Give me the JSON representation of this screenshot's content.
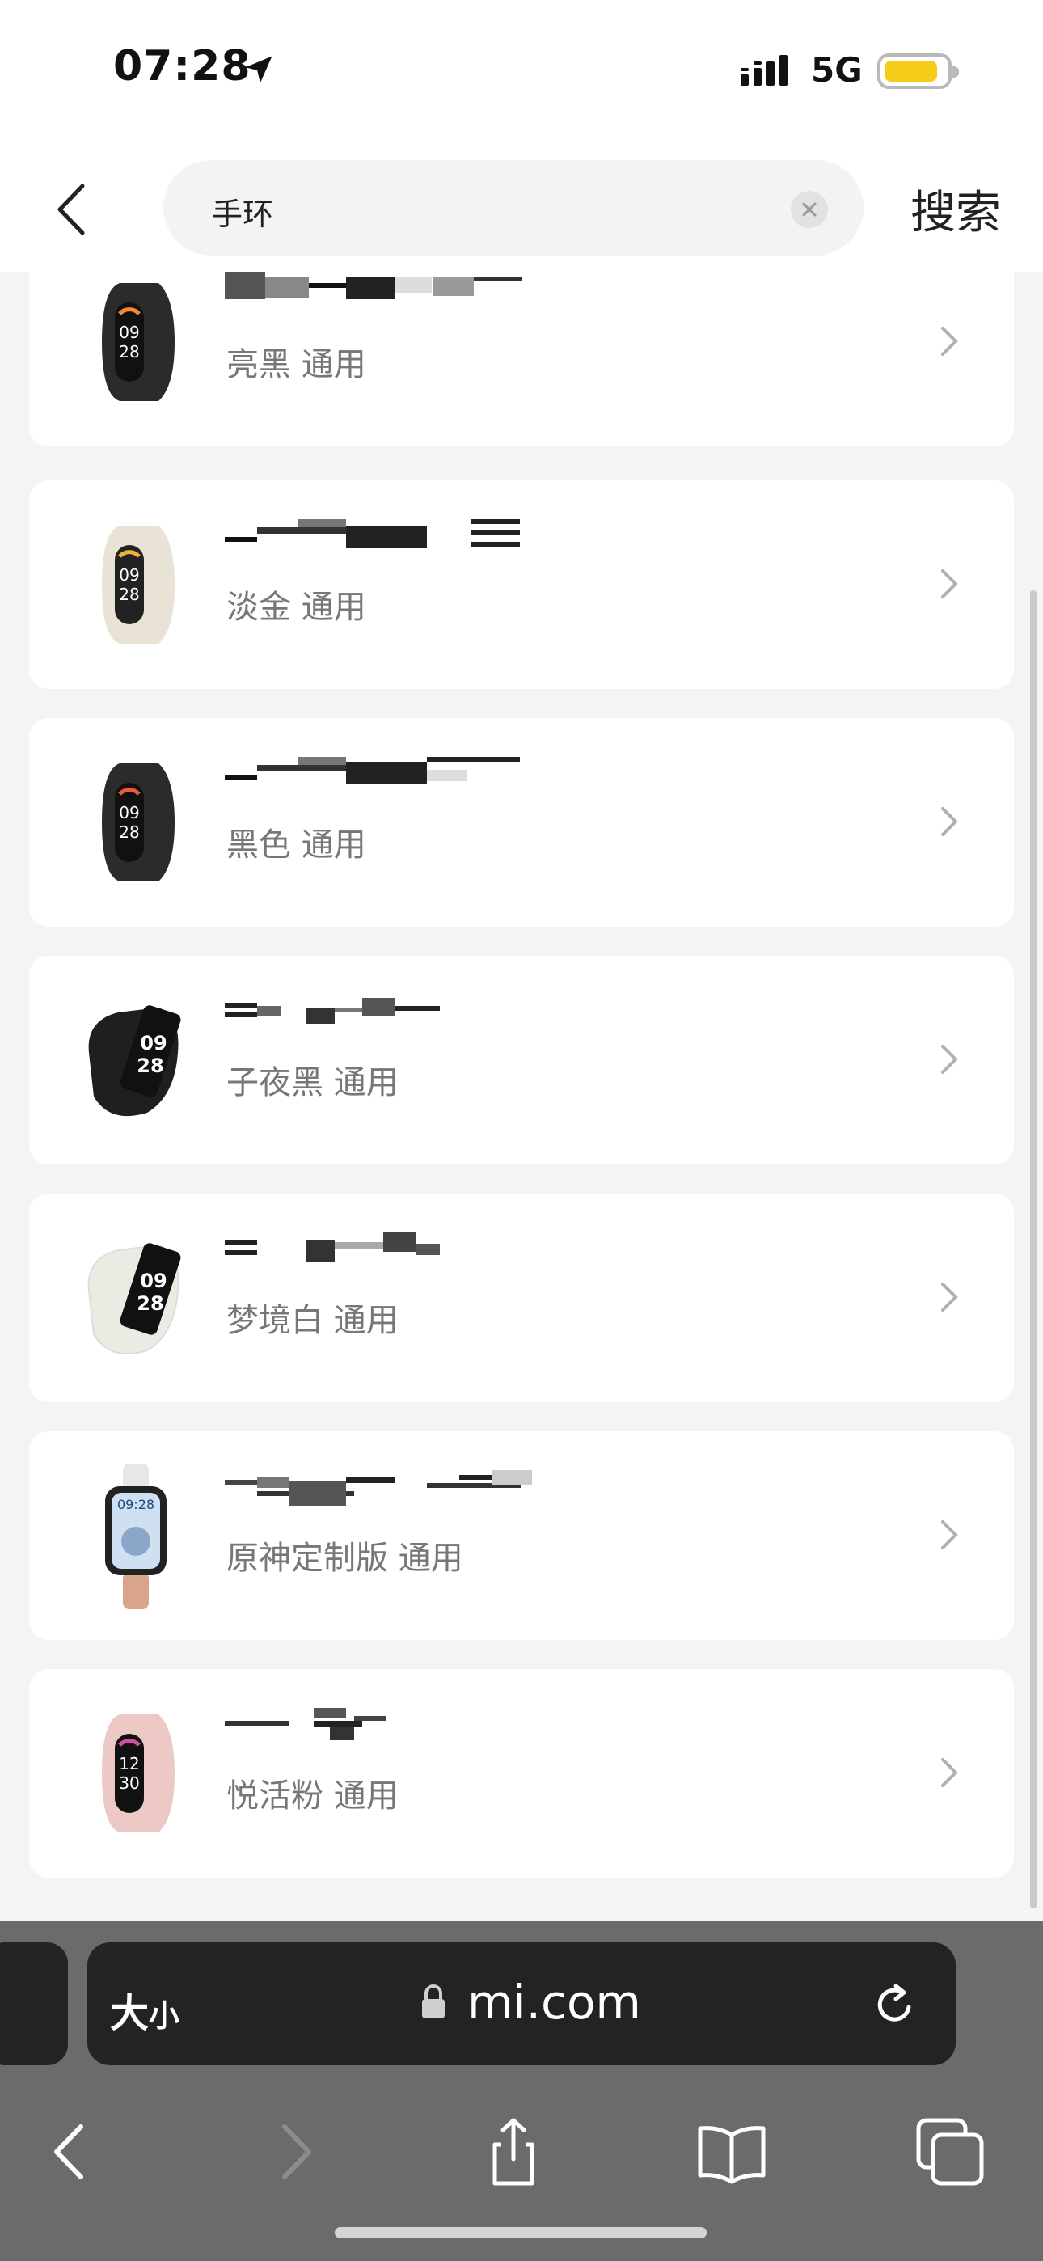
{
  "status_bar": {
    "time": "07:28",
    "network": "5G",
    "battery_color": "#f7cb1a",
    "icons": [
      "location-arrow-icon",
      "signal-icon",
      "battery-icon"
    ]
  },
  "header": {
    "search_value": "手环",
    "search_button": "搜索",
    "icons": [
      "back-icon",
      "clear-icon"
    ]
  },
  "products": [
    {
      "variant": "亮黑 通用",
      "band_color": "#2b2b2b",
      "shape": "oval"
    },
    {
      "variant": "淡金 通用",
      "band_color": "#e9e3d6",
      "shape": "oval"
    },
    {
      "variant": "黑色 通用",
      "band_color": "#2b2b2b",
      "shape": "oval"
    },
    {
      "variant": "子夜黑 通用",
      "band_color": "#1f1f1f",
      "shape": "rect"
    },
    {
      "variant": "梦境白 通用",
      "band_color": "#ecebe3",
      "shape": "rect"
    },
    {
      "variant": "原神定制版 通用",
      "band_color": "#e7e7ea",
      "shape": "square"
    },
    {
      "variant": "悦活粉 通用",
      "band_color": "#ecc9c5",
      "shape": "oval"
    }
  ],
  "browser": {
    "text_size_label": "大",
    "text_size_small": "小",
    "domain": "mi.com",
    "icons": [
      "lock-icon",
      "reload-icon",
      "back-icon",
      "forward-icon",
      "share-icon",
      "bookmarks-icon",
      "tabs-icon"
    ]
  }
}
